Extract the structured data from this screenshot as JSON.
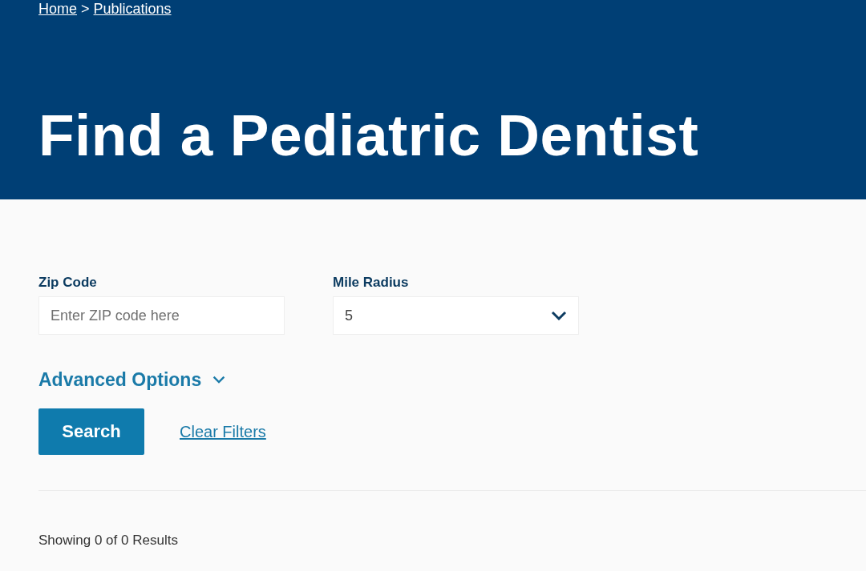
{
  "breadcrumb": [
    {
      "label": "Home"
    },
    {
      "label": "Publications"
    }
  ],
  "breadcrumb_separator": ">",
  "title": "Find a Pediatric Dentist",
  "fields": [
    {
      "kind": "text",
      "label": "Zip Code",
      "placeholder": "Enter ZIP code here"
    },
    {
      "kind": "select",
      "label": "Mile Radius",
      "value": "5"
    }
  ],
  "advanced_options": {
    "label": "Advanced Options",
    "expanded": false
  },
  "search_button": "Search",
  "clear_filters": "Clear Filters",
  "results_summary": "Showing 0 of 0 Results"
}
